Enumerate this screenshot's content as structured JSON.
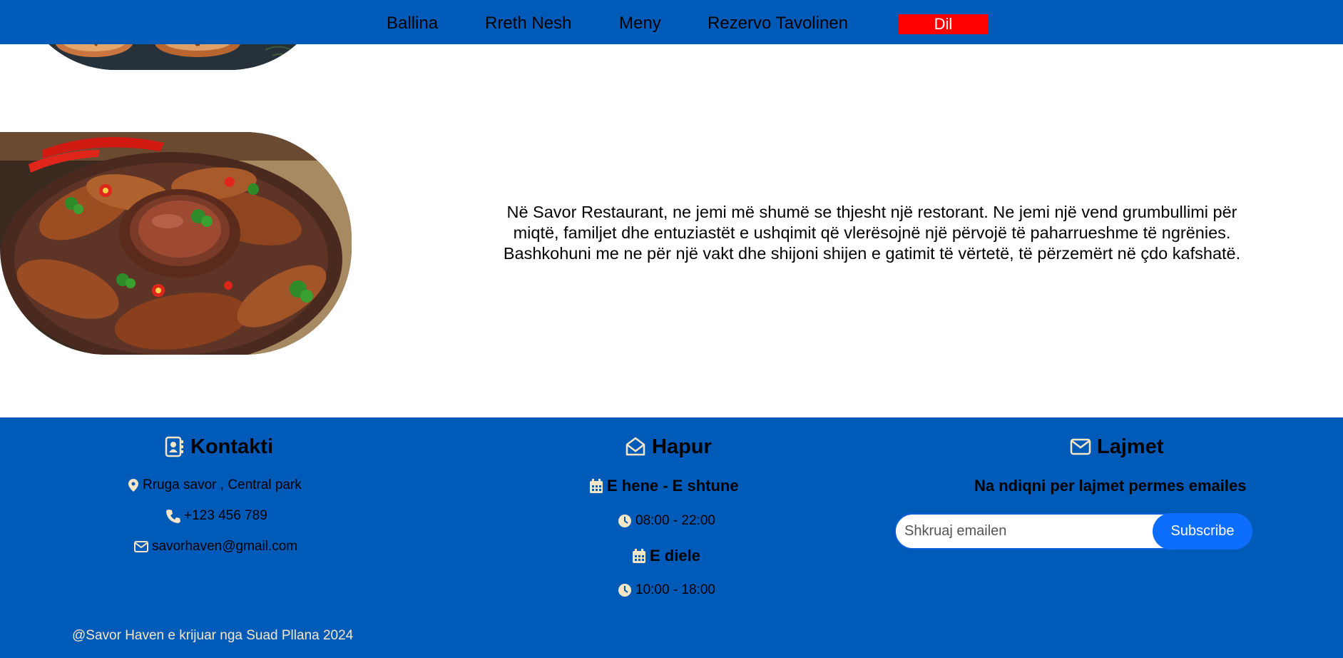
{
  "nav": {
    "items": [
      {
        "label": "Ballina"
      },
      {
        "label": "Rreth Nesh"
      },
      {
        "label": "Meny"
      },
      {
        "label": "Rezervo Tavolinen"
      }
    ],
    "logout_label": "Dil"
  },
  "about": {
    "text": "Në Savor Restaurant, ne jemi më shumë se thjesht një restorant. Ne jemi një vend grumbullimi për miqtë, familjet dhe entuziastët e ushqimit që vlerësojnë një përvojë të paharrueshme të ngrënies. Bashkohuni me ne për një vakt dhe shijoni shijen e gatimit të vërtetë, të përzemërt në çdo kafshatë."
  },
  "footer": {
    "contact": {
      "title": "Kontakti",
      "address": "Rruga savor , Central park",
      "phone": "+123 456 789",
      "email": "savorhaven@gmail.com"
    },
    "hours": {
      "title": "Hapur",
      "weekday_label": "E hene - E shtune",
      "weekday_hours": "08:00 - 22:00",
      "sunday_label": "E diele",
      "sunday_hours": "10:00 - 18:00"
    },
    "news": {
      "title": "Lajmet",
      "subtitle": "Na ndiqni per lajmet permes emailes",
      "placeholder": "Shkruaj emailen",
      "button_label": "Subscribe"
    },
    "copyright": "@Savor Haven e krijuar nga Suad Pllana 2024"
  },
  "colors": {
    "brand_blue": "#005bb8",
    "logout_red": "#ff0000",
    "footer_text": "#f6e6c7",
    "subscribe_blue": "#0d6efd"
  },
  "icons": [
    "contact-card-icon",
    "map-pin-icon",
    "phone-icon",
    "envelope-icon",
    "envelope-open-icon",
    "calendar-icon",
    "clock-icon"
  ]
}
